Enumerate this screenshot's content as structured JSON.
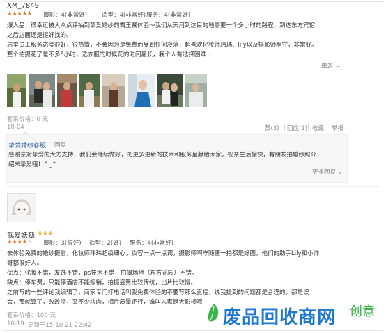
{
  "review1": {
    "username": "XM_7849",
    "ratings": [
      {
        "label": "摄影：4(非常好)"
      },
      {
        "label": "造型：4(非常好)"
      },
      {
        "label": "服务：4(非常好)"
      }
    ],
    "star_count": 5,
    "text_lines": [
      "爆人品，很幸运被大众点评抽到挚爱婚纱的霸王餐体验～我们从天河到达目的地需要一个多小时的路程，到达东方宾馆",
      "之后店面还是挺好找的。",
      "店里员工服务态度很好，很热情，不会因为是免费而受到任何冷落，超喜欢化妆师玮玮、lily以及摄影师啊守，非常好。",
      "整个拍摄花了差不多5小时，选衣服的时候花的时间最长，我个人有选择困难..."
    ],
    "more_label": "更多",
    "price": "套系价格：0 元",
    "date": "10-04",
    "actions": {
      "like": "赞(3)",
      "reply": "回应(1)",
      "favorite": "收藏",
      "report": "举报"
    }
  },
  "merchant_reply": {
    "name": "挚爱婚纱客服",
    "reply_label": "回复",
    "text_lines": [
      "感谢亲对挚爱的大力支持，我们会继续做好，把更多更新的技术和服务呈献给大家。祝亲生活愉快，有朋友拍婚纱照介",
      "绍来挚爱哦！^_^"
    ],
    "more_reply_label": "更多回复"
  },
  "review2": {
    "username": "我爱妖孤",
    "ratings": [
      {
        "label": "摄影：3(很好)"
      },
      {
        "label": "造型：2(好)"
      },
      {
        "label": "服务：4(非常好)"
      }
    ],
    "star_count": 4,
    "text_lines": [
      "去体验免费的婚纱摄影，化妆师玮玮超级细心，妆容一点一点调，摄影师啊守随便一拍都是好图，他们的助手Lily和小帅",
      "哥都很好人。",
      "优点：化妆不错，发饰不错，ps技术不错，拍摄场地（东方花园）不错。",
      "缺点：停车费，只能停酒店不能报销，拍摄姿势比较传统，出片比较慢。",
      "之前写的一些评论我编辑了，商家专门打电话叫我免费体验的不要写那么直接，说我提到的问题都是合理的，都是误",
      "会，那就算了，改改呗，又不少块肉，相片质量还行，谁叫人家是大影楼呢"
    ],
    "price": "套系价格：100 元",
    "date": "10-19",
    "edited": "更新于15-10-21 22:42"
  },
  "watermark": {
    "text": "废品回收商网",
    "tagline": "创意"
  }
}
